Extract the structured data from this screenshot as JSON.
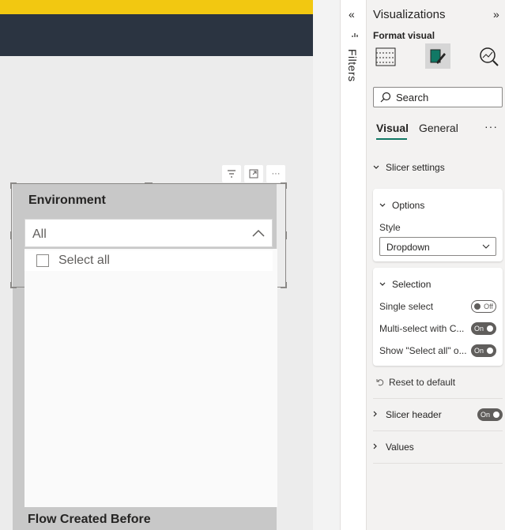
{
  "slicer": {
    "title": "Environment",
    "dropdown_value": "All",
    "select_all_label": "Select all",
    "next_visual_title": "Flow Created Before"
  },
  "filters": {
    "label": "Filters",
    "collapse_glyph": "«"
  },
  "visualizations": {
    "title": "Visualizations",
    "expand_glyph": "»",
    "subtitle": "Format visual",
    "search_placeholder": "Search",
    "tabs": [
      {
        "label": "Visual",
        "active": true
      },
      {
        "label": "General",
        "active": false
      }
    ],
    "more_glyph": "···",
    "sections": {
      "slicer_settings": "Slicer settings",
      "options": {
        "title": "Options",
        "style_label": "Style",
        "style_value": "Dropdown"
      },
      "selection": {
        "title": "Selection",
        "rows": [
          {
            "label": "Single select",
            "state": "Off"
          },
          {
            "label": "Multi-select with C...",
            "state": "On"
          },
          {
            "label": "Show \"Select all\" o...",
            "state": "On"
          }
        ]
      },
      "reset_label": "Reset to default",
      "slicer_header": {
        "label": "Slicer header",
        "state": "On"
      },
      "values": "Values"
    }
  },
  "colors": {
    "brand_yellow": "#f2c811",
    "header_dark": "#2b3441",
    "active_tab_underline": "#117865"
  }
}
